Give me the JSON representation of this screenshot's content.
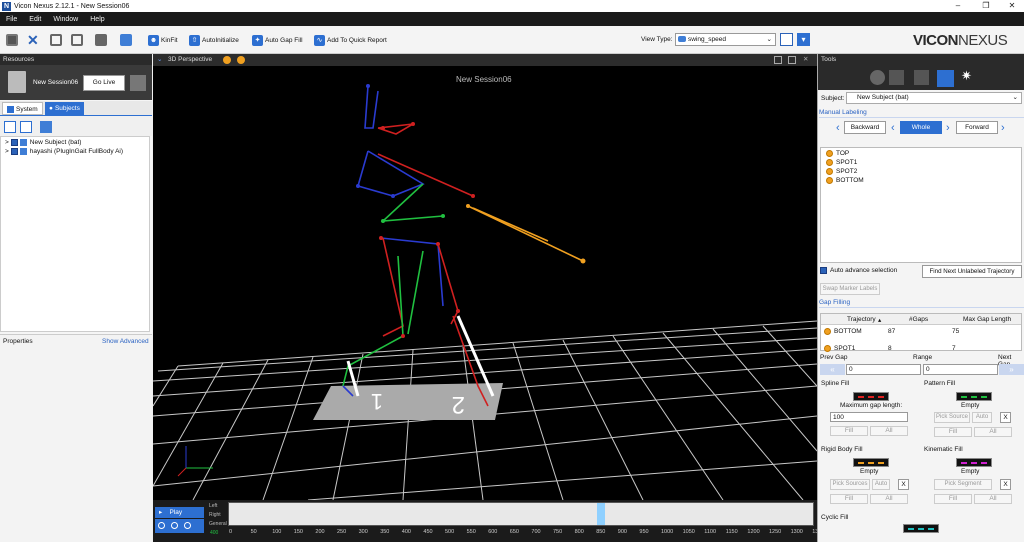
{
  "window": {
    "title": "Vicon Nexus 2.12.1 - New Session06",
    "minimize": "–",
    "maximize": "❐",
    "close": "✕"
  },
  "menu": [
    "File",
    "Edit",
    "Window",
    "Help"
  ],
  "toolbar": {
    "kinfit": "KinFit",
    "autoinit": "AutoInitialize",
    "autogap": "Auto Gap Fill",
    "quickreport": "Add To Quick Report",
    "view_type_label": "View Type:",
    "view_type_value": "swing_speed"
  },
  "brand": {
    "vicon": "VICON",
    "nexus": "NEXUS"
  },
  "resources": {
    "header": "Resources",
    "session": "New Session06",
    "go_live": "Go Live"
  },
  "tabs": {
    "system": "System",
    "subjects": "Subjects"
  },
  "subjects": [
    {
      "name": "New Subject (bat)"
    },
    {
      "name": "hayashi (PlugInGait FullBody Ai)"
    }
  ],
  "properties": {
    "header": "Properties",
    "show_advanced": "Show Advanced"
  },
  "viewport": {
    "header": "3D Perspective",
    "session_label": "New Session06"
  },
  "timeline": {
    "play": "Play",
    "left": "Left",
    "right": "Right",
    "general": "General",
    "frame_marker": "400",
    "ticks": [
      "0",
      "50",
      "100",
      "150",
      "200",
      "250",
      "300",
      "350",
      "400",
      "450",
      "500",
      "550",
      "600",
      "650",
      "700",
      "750",
      "800",
      "850",
      "900",
      "950",
      "1000",
      "1050",
      "1100",
      "1150",
      "1200",
      "1250",
      "1300",
      "135"
    ]
  },
  "tools": {
    "header": "Tools",
    "subject_label": "Subject:",
    "subject_value": "New Subject (bat)",
    "manual_labeling": "Manual Labeling",
    "backward": "Backward",
    "whole": "Whole",
    "forward": "Forward",
    "markers": [
      "TOP",
      "SPOT1",
      "SPOT2",
      "BOTTOM"
    ],
    "auto_advance": "Auto advance selection",
    "find_next": "Find Next Unlabeled Trajectory",
    "swap": "Swap Marker Labels",
    "gap_filling": "Gap Filling",
    "gap_table": {
      "headers": [
        "Trajectory",
        "#Gaps",
        "Max Gap Length"
      ],
      "rows": [
        [
          "BOTTOM",
          "87",
          "75"
        ],
        [
          "SPOT1",
          "8",
          "7"
        ]
      ]
    },
    "prev_gap": "Prev Gap",
    "range": "Range",
    "next_gap": "Next Gap",
    "range_from": "0",
    "range_to": "0",
    "spline_fill": "Spline Fill",
    "max_gap_label": "Maximum gap length:",
    "max_gap_value": "100",
    "pattern_fill": "Pattern Fill",
    "empty": "Empty",
    "pick_source": "Pick Source",
    "auto": "Auto",
    "x": "X",
    "fill": "Fill",
    "all": "All",
    "rigid_fill": "Rigid Body Fill",
    "pick_sources": "Pick Sources",
    "kinematic_fill": "Kinematic Fill",
    "pick_segment": "Pick Segment",
    "cyclic_fill": "Cyclic Fill"
  },
  "colors": {
    "accent": "#2d6fd1",
    "spline": "#e02020",
    "pattern": "#20c040",
    "rigid": "#f0a020",
    "kinematic": "#d020d0",
    "cyclic": "#20c0c0"
  }
}
